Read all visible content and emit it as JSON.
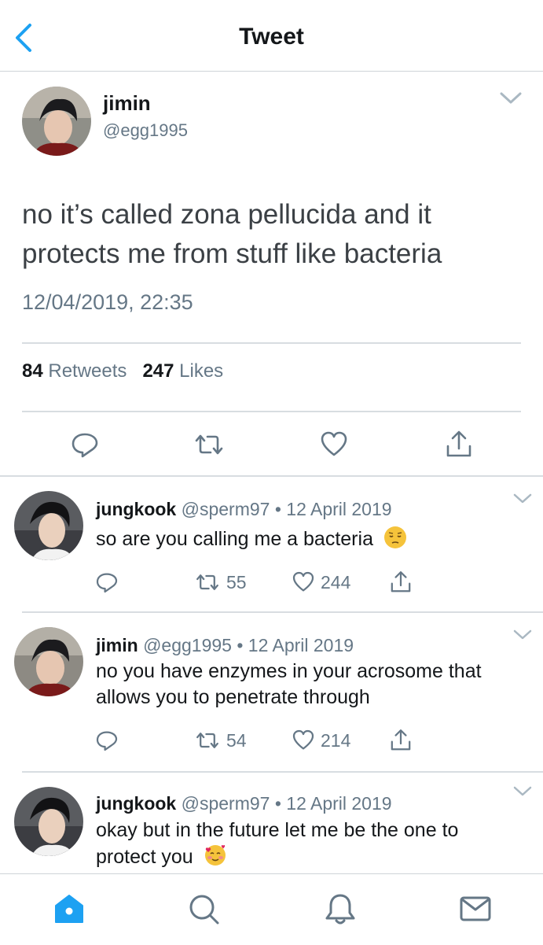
{
  "header": {
    "title": "Tweet"
  },
  "tweet": {
    "name": "jimin",
    "handle": "@egg1995",
    "text": "no it’s called zona pellucida and it protects me from stuff like bacteria",
    "timestamp": "12/04/2019, 22:35",
    "retweets_count": "84",
    "retweets_label": "Retweets",
    "likes_count": "247",
    "likes_label": "Likes"
  },
  "replies": [
    {
      "name": "jungkook",
      "meta": "@sperm97 • 12 April 2019",
      "text": "so are you calling me a bacteria",
      "emoji": "pensive-face-emoji",
      "retweets": "55",
      "likes": "244"
    },
    {
      "name": "jimin",
      "meta": "@egg1995 • 12 April 2019",
      "text": "no you have enzymes in your acrosome that allows you to penetrate through",
      "retweets": "54",
      "likes": "214"
    },
    {
      "name": "jungkook",
      "meta": "@sperm97 • 12 April 2019",
      "text": "okay but in the future let me be the one to protect you",
      "emoji": "smiling-face-with-hearts-emoji"
    }
  ],
  "colors": {
    "accent": "#1da1f2",
    "secondary_text": "#657786",
    "divider": "#d8dde1"
  },
  "icons": {
    "header": "back-chevron-icon",
    "actions": [
      "reply-icon",
      "retweet-icon",
      "like-icon",
      "share-icon"
    ],
    "tabs": [
      "home-icon",
      "search-icon",
      "notifications-icon",
      "messages-icon"
    ]
  }
}
